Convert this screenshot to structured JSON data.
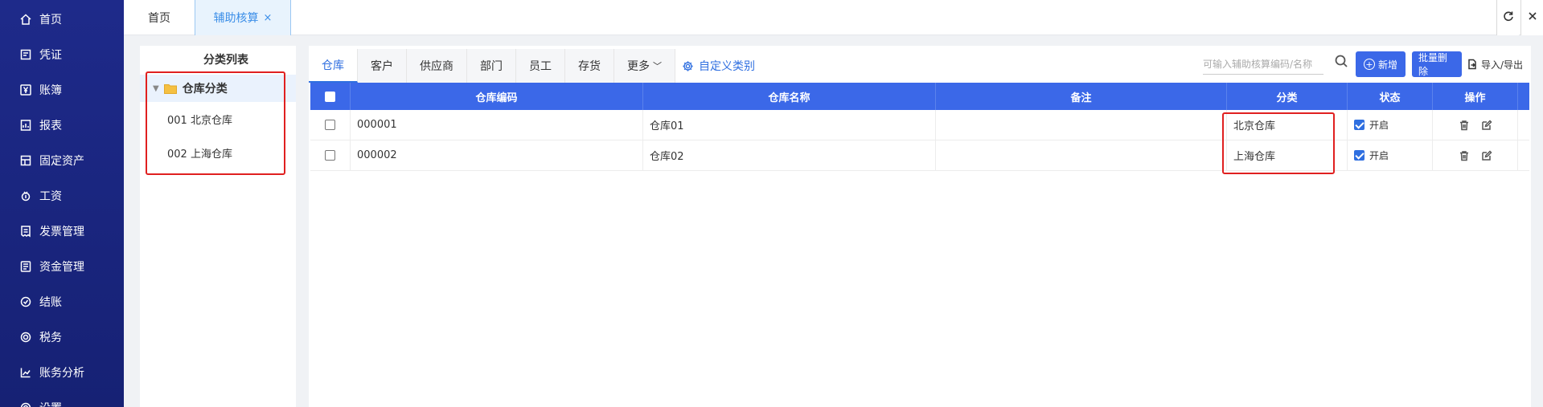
{
  "sidebar": {
    "items": [
      {
        "label": "首页",
        "icon": "home-icon"
      },
      {
        "label": "凭证",
        "icon": "voucher-icon"
      },
      {
        "label": "账簿",
        "icon": "yen-icon"
      },
      {
        "label": "报表",
        "icon": "report-icon"
      },
      {
        "label": "固定资产",
        "icon": "asset-icon"
      },
      {
        "label": "工资",
        "icon": "salary-icon"
      },
      {
        "label": "发票管理",
        "icon": "invoice-icon"
      },
      {
        "label": "资金管理",
        "icon": "fund-icon"
      },
      {
        "label": "结账",
        "icon": "close-account-icon"
      },
      {
        "label": "税务",
        "icon": "tax-icon"
      },
      {
        "label": "账务分析",
        "icon": "analysis-icon"
      },
      {
        "label": "设置",
        "icon": "settings-icon"
      }
    ]
  },
  "topbar": {
    "home_tab": "首页",
    "active_tab": "辅助核算",
    "close_glyph": "×"
  },
  "tree": {
    "title": "分类列表",
    "root": "仓库分类",
    "children": [
      "001 北京仓库",
      "002 上海仓库"
    ]
  },
  "tabs": {
    "items": [
      "仓库",
      "客户",
      "供应商",
      "部门",
      "员工",
      "存货",
      "更多"
    ],
    "custom": "自定义类别"
  },
  "toolbar": {
    "search_placeholder": "可输入辅助核算编码/名称",
    "new_label": "新增",
    "batch_delete_label": "批量删除",
    "import_export_label": "导入/导出"
  },
  "table": {
    "headers": [
      "仓库编码",
      "仓库名称",
      "备注",
      "分类",
      "状态",
      "操作"
    ],
    "rows": [
      {
        "code": "000001",
        "name": "仓库01",
        "remark": "",
        "category": "北京仓库",
        "status": "开启"
      },
      {
        "code": "000002",
        "name": "仓库02",
        "remark": "",
        "category": "上海仓库",
        "status": "开启"
      }
    ]
  },
  "colors": {
    "sidebar": "#1e2a8a",
    "primary": "#3b68e8",
    "highlight": "#e02020"
  }
}
